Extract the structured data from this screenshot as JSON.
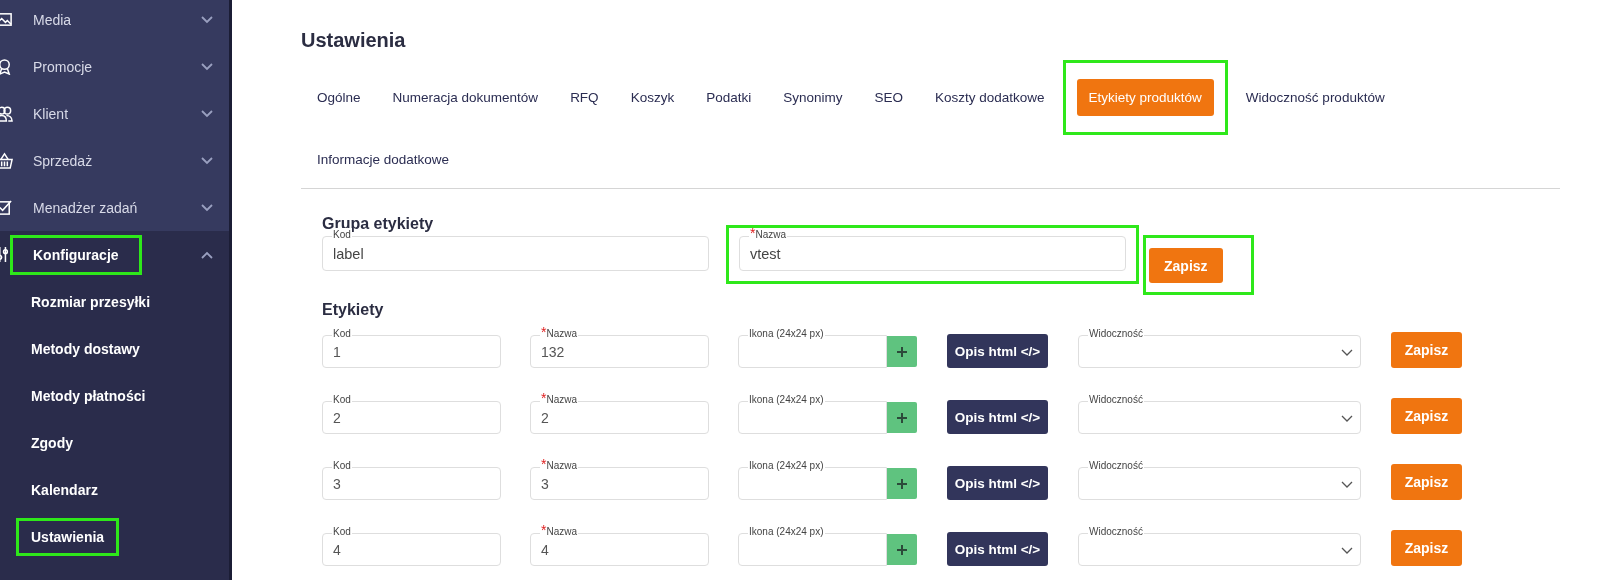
{
  "sidebar": {
    "items": [
      {
        "label": "Media",
        "expanded": false,
        "highlighted": false
      },
      {
        "label": "Promocje",
        "expanded": false,
        "highlighted": false
      },
      {
        "label": "Klient",
        "expanded": false,
        "highlighted": false
      },
      {
        "label": "Sprzedaż",
        "expanded": false,
        "highlighted": false
      },
      {
        "label": "Menadżer zadań",
        "expanded": false,
        "highlighted": false
      },
      {
        "label": "Konfiguracje",
        "expanded": true,
        "highlighted": true,
        "children": [
          {
            "label": "Rozmiar przesyłki",
            "highlighted": false
          },
          {
            "label": "Metody dostawy",
            "highlighted": false
          },
          {
            "label": "Metody płatności",
            "highlighted": false
          },
          {
            "label": "Zgody",
            "highlighted": false
          },
          {
            "label": "Kalendarz",
            "highlighted": false
          },
          {
            "label": "Ustawienia",
            "highlighted": true
          }
        ]
      }
    ]
  },
  "page_title": "Ustawienia",
  "tabs": [
    {
      "label": "Ogólne",
      "selected": false,
      "highlighted": false
    },
    {
      "label": "Numeracja dokumentów",
      "selected": false,
      "highlighted": false
    },
    {
      "label": "RFQ",
      "selected": false,
      "highlighted": false
    },
    {
      "label": "Koszyk",
      "selected": false,
      "highlighted": false
    },
    {
      "label": "Podatki",
      "selected": false,
      "highlighted": false
    },
    {
      "label": "Synonimy",
      "selected": false,
      "highlighted": false
    },
    {
      "label": "SEO",
      "selected": false,
      "highlighted": false
    },
    {
      "label": "Koszty dodatkowe",
      "selected": false,
      "highlighted": false
    },
    {
      "label": "Etykiety produktów",
      "selected": true,
      "highlighted": true
    },
    {
      "label": "Widoczność produktów",
      "selected": false,
      "highlighted": false
    },
    {
      "label": "Informacje dodatkowe",
      "selected": false,
      "highlighted": false
    }
  ],
  "label_group": {
    "heading": "Grupa etykiety",
    "fields": [
      {
        "label": "Kod",
        "value": "label",
        "highlighted": false
      },
      {
        "required_mark": "*",
        "label": "Nazwa",
        "value": "vtest",
        "highlighted": true
      }
    ],
    "save_button": {
      "label": "Zapisz",
      "highlighted": true
    }
  },
  "labels": {
    "heading": "Etykiety",
    "rows": [
      {
        "code_label": "Kod",
        "code": "1",
        "name_required_mark": "*",
        "name_label": "Nazwa",
        "name": "132",
        "icon_label": "Ikona (24x24 px)",
        "html_button": "Opis html </>",
        "visibility_label": "Widoczność",
        "save_button": "Zapisz"
      },
      {
        "code_label": "Kod",
        "code": "2",
        "name_required_mark": "*",
        "name_label": "Nazwa",
        "name": "2",
        "icon_label": "Ikona (24x24 px)",
        "html_button": "Opis html </>",
        "visibility_label": "Widoczność",
        "save_button": "Zapisz"
      },
      {
        "code_label": "Kod",
        "code": "3",
        "name_required_mark": "*",
        "name_label": "Nazwa",
        "name": "3",
        "icon_label": "Ikona (24x24 px)",
        "html_button": "Opis html </>",
        "visibility_label": "Widoczność",
        "save_button": "Zapisz"
      },
      {
        "code_label": "Kod",
        "code": "4",
        "name_required_mark": "*",
        "name_label": "Nazwa",
        "name": "4",
        "icon_label": "Ikona (24x24 px)",
        "html_button": "Opis html </>",
        "visibility_label": "Widoczność",
        "save_button": "Zapisz"
      }
    ]
  }
}
